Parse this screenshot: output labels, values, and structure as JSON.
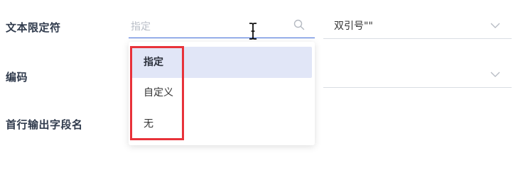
{
  "form": {
    "text_qualifier_label": "文本限定符",
    "encoding_label": "编码",
    "header_label": "首行输出字段名"
  },
  "qualifier_input": {
    "placeholder": "指定",
    "search_icon": "search-icon"
  },
  "quote_select": {
    "value": "双引号\"\"",
    "chevron_icon": "chevron-down-icon"
  },
  "encoding_select": {
    "value": "",
    "chevron_icon": "chevron-down-icon"
  },
  "dropdown": {
    "options": [
      {
        "label": "指定",
        "selected": true
      },
      {
        "label": "自定义",
        "selected": false
      },
      {
        "label": "无",
        "selected": false
      }
    ]
  },
  "annotation": {
    "highlight_color": "#e8323a"
  },
  "colors": {
    "focus_border": "#3e6bd9",
    "selected_bg": "#e1e6f7"
  }
}
